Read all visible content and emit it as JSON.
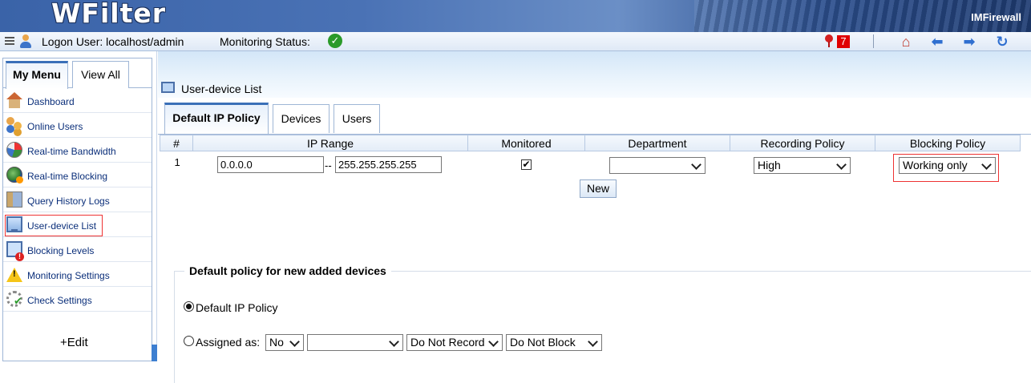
{
  "banner": {
    "brand": "WFilter",
    "product": "IMFirewall"
  },
  "status": {
    "logon_user": "Logon User: localhost/admin",
    "monitoring_status_label": "Monitoring Status:",
    "alert_count": "7"
  },
  "sidebar": {
    "tabs": [
      {
        "label": "My Menu"
      },
      {
        "label": "View All"
      }
    ],
    "items": [
      {
        "label": "Dashboard"
      },
      {
        "label": "Online Users"
      },
      {
        "label": "Real-time Bandwidth"
      },
      {
        "label": "Real-time Blocking"
      },
      {
        "label": "Query History Logs"
      },
      {
        "label": "User-device List"
      },
      {
        "label": "Blocking Levels"
      },
      {
        "label": "Monitoring Settings"
      },
      {
        "label": "Check Settings"
      }
    ],
    "edit_label": "+Edit"
  },
  "page": {
    "title": "User-device List"
  },
  "tabs": [
    {
      "label": "Default IP Policy"
    },
    {
      "label": "Devices"
    },
    {
      "label": "Users"
    }
  ],
  "table": {
    "headers": [
      "#",
      "IP Range",
      "Monitored",
      "Department",
      "Recording Policy",
      "Blocking Policy"
    ],
    "rows": [
      {
        "index": "1",
        "ip_start": "0.0.0.0",
        "ip_separator": "--",
        "ip_end": "255.255.255.255",
        "monitored": "✔",
        "department": "",
        "recording_policy": "High",
        "blocking_policy": "Working only"
      }
    ],
    "new_button": "New"
  },
  "defaults": {
    "legend": "Default policy for new added devices",
    "option_default": "Default IP Policy",
    "option_assigned": "Assigned as:",
    "assigned_monitor": "No",
    "assigned_department": "",
    "assigned_recording": "Do Not Record",
    "assigned_blocking": "Do Not Block"
  },
  "colors": {
    "accent": "#3a6fb8",
    "highlight": "#e33333",
    "badge": "#e00000",
    "link": "#0b2f7a"
  }
}
